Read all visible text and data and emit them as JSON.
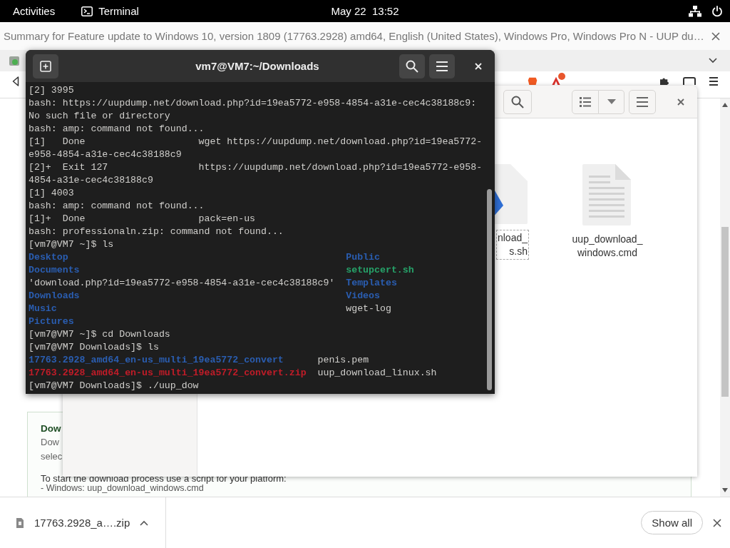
{
  "top_bar": {
    "activities": "Activities",
    "app": "Terminal",
    "clock": "May 22  13:52"
  },
  "browser": {
    "title": "Summary for Feature update to Windows 10, version 1809 (17763.2928) amd64, English (United States), Windows Pro, Windows Pro N - UUP du…",
    "extension_badge": true,
    "card": {
      "heading": "Dow",
      "lines": [
        "Dow",
        "selec"
      ],
      "instruction": "To start the download process use a script for your platform:",
      "script_line": "- Windows: uup_download_windows.cmd"
    },
    "download_bar": {
      "file": "17763.2928_a….zip",
      "show_all": "Show all"
    }
  },
  "file_manager": {
    "files": [
      {
        "name_lines": [
          "nload_",
          "s.sh"
        ],
        "kind": "script",
        "focused": true
      },
      {
        "name_lines": [
          "uup_download_",
          "windows.cmd"
        ],
        "kind": "text",
        "focused": false
      }
    ]
  },
  "terminal": {
    "title": "vm7@VM7:~/Downloads",
    "lines": [
      {
        "kind": "text",
        "text": "[2] 3995"
      },
      {
        "kind": "text",
        "text": "bash: https://uupdump.net/download.php?id=19ea5772-e958-4854-a31e-cec4c38188c9:"
      },
      {
        "kind": "text",
        "text": "No such file or directory"
      },
      {
        "kind": "text",
        "text": "bash: amp: command not found..."
      },
      {
        "kind": "job",
        "id": "[1]",
        "status": "Done",
        "command": "wget https://uupdump.net/download.php?id=19ea5772-"
      },
      {
        "kind": "text",
        "text": "e958-4854-a31e-cec4c38188c9"
      },
      {
        "kind": "job",
        "id": "[2]+",
        "status": "Exit 127",
        "command": "https://uupdump.net/download.php?id=19ea5772-e958-"
      },
      {
        "kind": "text",
        "text": "4854-a31e-cec4c38188c9"
      },
      {
        "kind": "text",
        "text": "[1] 4003"
      },
      {
        "kind": "text",
        "text": "bash: amp: command not found..."
      },
      {
        "kind": "job",
        "id": "[1]+",
        "status": "Done",
        "command": "pack=en-us"
      },
      {
        "kind": "text",
        "text": "bash: professionaln.zip: command not found..."
      },
      {
        "kind": "text",
        "text": "[vm7@VM7 ~]$ ls"
      },
      {
        "kind": "listing",
        "rows": [
          [
            {
              "text": "Desktop",
              "kind": "dir"
            },
            {
              "text": "Public",
              "kind": "dir"
            }
          ],
          [
            {
              "text": "Documents",
              "kind": "dir"
            },
            {
              "text": "setupcert.sh",
              "kind": "exec"
            }
          ],
          [
            {
              "text": "'download.php?id=19ea5772-e958-4854-a31e-cec4c38188c9'",
              "kind": "file"
            },
            {
              "text": "Templates",
              "kind": "dir"
            }
          ],
          [
            {
              "text": "Downloads",
              "kind": "dir"
            },
            {
              "text": "Videos",
              "kind": "dir"
            }
          ],
          [
            {
              "text": "Music",
              "kind": "dir"
            },
            {
              "text": "wget-log",
              "kind": "file"
            }
          ],
          [
            {
              "text": "Pictures",
              "kind": "dir"
            }
          ]
        ]
      },
      {
        "kind": "text",
        "text": "[vm7@VM7 ~]$ cd Downloads"
      },
      {
        "kind": "text",
        "text": "[vm7@VM7 Downloads]$ ls"
      },
      {
        "kind": "listing",
        "rows": [
          [
            {
              "text": "17763.2928_amd64_en-us_multi_19ea5772_convert",
              "kind": "dir"
            },
            {
              "text": "penis.pem",
              "kind": "file"
            }
          ],
          [
            {
              "text": "17763.2928_amd64_en-us_multi_19ea5772_convert.zip",
              "kind": "archive"
            },
            {
              "text": "uup_download_linux.sh",
              "kind": "file"
            }
          ]
        ]
      },
      {
        "kind": "text",
        "text": "[vm7@VM7 Downloads]$ ./uup_dow"
      }
    ]
  }
}
